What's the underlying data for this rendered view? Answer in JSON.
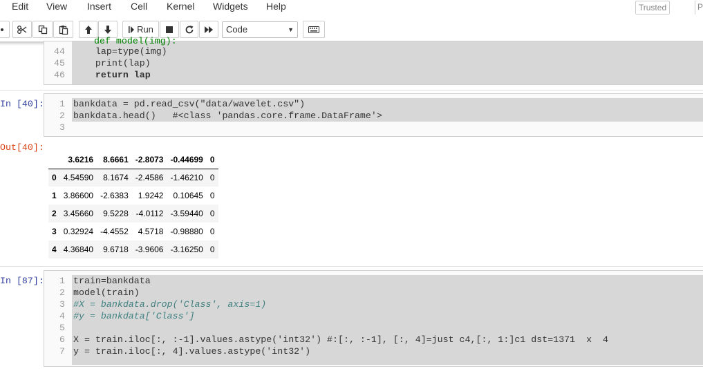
{
  "menu": [
    "Edit",
    "View",
    "Insert",
    "Cell",
    "Kernel",
    "Widgets",
    "Help"
  ],
  "trusted": "Trusted",
  "kernel_indicator": "P",
  "toolbar": {
    "run_label": "Run",
    "cell_type": "Code"
  },
  "cell1": {
    "partial": "def model(img):",
    "line_numbers": [
      "44",
      "45",
      "46"
    ],
    "lines": [
      "    lap=type(img)",
      "    print(lap)",
      "    return lap"
    ]
  },
  "cell2": {
    "prompt": "In [40]:",
    "line_numbers": [
      "1",
      "2",
      "3"
    ],
    "lines": [
      "bankdata = pd.read_csv(\"data/wavelet.csv\")",
      "bankdata.head()   #<class 'pandas.core.frame.DataFrame'>",
      ""
    ]
  },
  "output": {
    "prompt": "Out[40]:",
    "columns": [
      "",
      "3.6216",
      "8.6661",
      "-2.8073",
      "-0.44699",
      "0"
    ],
    "rows": [
      [
        "0",
        "4.54590",
        "8.1674",
        "-2.4586",
        "-1.46210",
        "0"
      ],
      [
        "1",
        "3.86600",
        "-2.6383",
        "1.9242",
        "0.10645",
        "0"
      ],
      [
        "2",
        "3.45660",
        "9.5228",
        "-4.0112",
        "-3.59440",
        "0"
      ],
      [
        "3",
        "0.32924",
        "-4.4552",
        "4.5718",
        "-0.98880",
        "0"
      ],
      [
        "4",
        "4.36840",
        "9.6718",
        "-3.9606",
        "-3.16250",
        "0"
      ]
    ]
  },
  "cell3": {
    "prompt": "In [87]:",
    "line_numbers": [
      "1",
      "2",
      "3",
      "4",
      "5",
      "6",
      "7"
    ],
    "lines": [
      "train=bankdata",
      "model(train)",
      "#X = bankdata.drop('Class', axis=1)",
      "#y = bankdata['Class']",
      "",
      "X = train.iloc[:, :-1].values.astype('int32') #:[:, :-1], [:, 4]=just c4,[:, 1:]c1 dst=1371  x  4",
      "y = train.iloc[:, 4].values.astype('int32')"
    ]
  }
}
